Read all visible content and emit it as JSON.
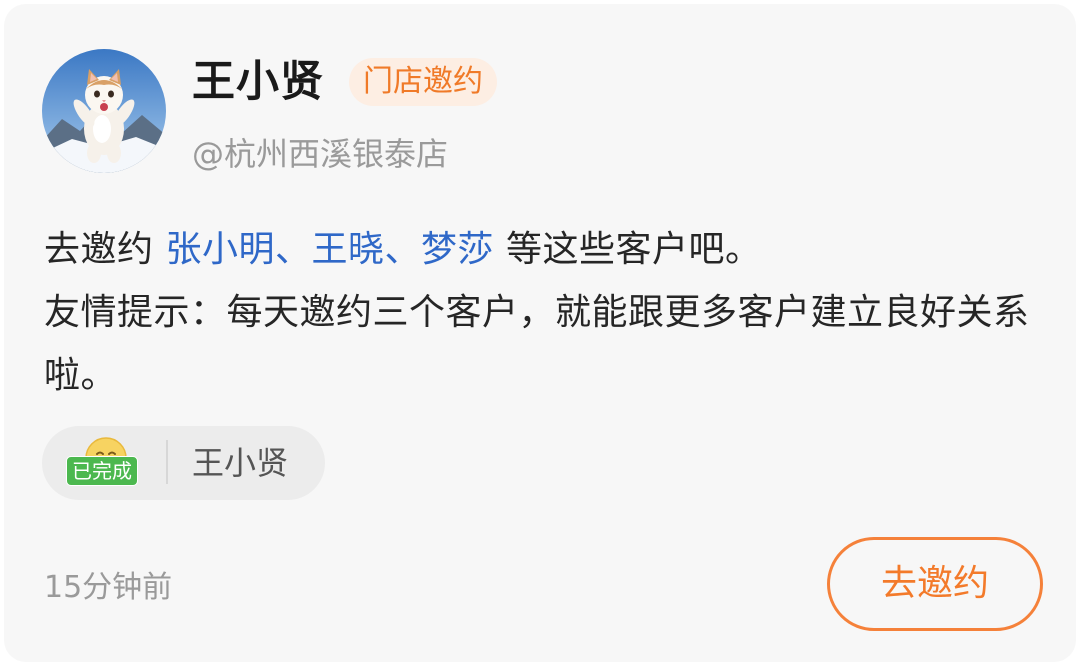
{
  "post": {
    "username": "王小贤",
    "tag": "门店邀约",
    "handle": "@杭州西溪银泰店",
    "avatar": {
      "icon": "cat-avatar-icon"
    },
    "message": {
      "prefix": "去邀约 ",
      "customers": [
        "张小明",
        "王晓",
        "梦莎"
      ],
      "separator": "、",
      "suffix": " 等这些客户吧。",
      "tip": "友情提示：每天邀约三个客户，就能跟更多客户建立良好关系啦。"
    },
    "status": {
      "badge": "已完成",
      "icon": "smile-emoji-icon",
      "name": "王小贤"
    },
    "time": "15分钟前",
    "action_label": "去邀约"
  },
  "colors": {
    "accent": "#f37a2a",
    "link": "#2f68c8",
    "success": "#4cb84f",
    "card_bg": "#f7f7f7"
  }
}
